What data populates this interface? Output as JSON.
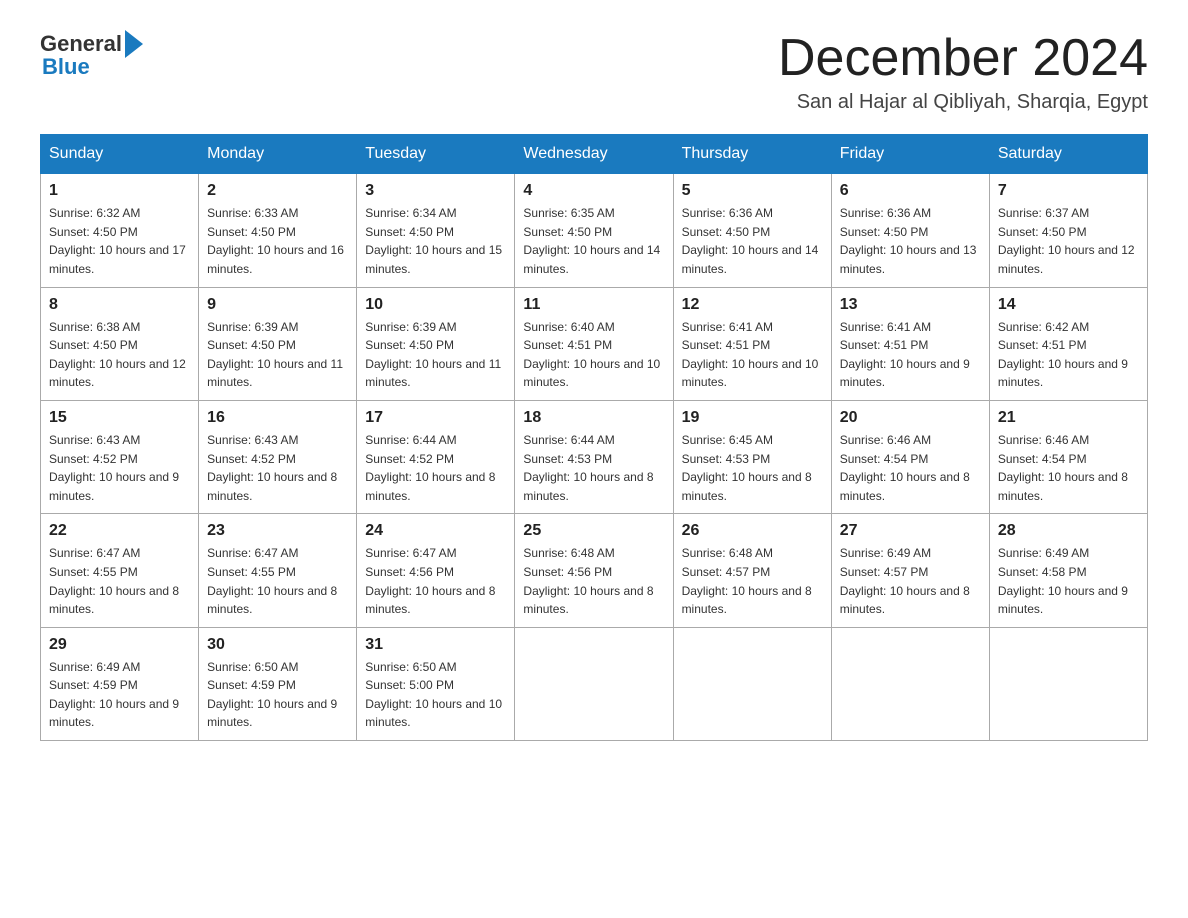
{
  "logo": {
    "general": "General",
    "blue": "Blue"
  },
  "header": {
    "month": "December 2024",
    "location": "San al Hajar al Qibliyah, Sharqia, Egypt"
  },
  "weekdays": [
    "Sunday",
    "Monday",
    "Tuesday",
    "Wednesday",
    "Thursday",
    "Friday",
    "Saturday"
  ],
  "weeks": [
    [
      {
        "day": "1",
        "sunrise": "6:32 AM",
        "sunset": "4:50 PM",
        "daylight": "10 hours and 17 minutes."
      },
      {
        "day": "2",
        "sunrise": "6:33 AM",
        "sunset": "4:50 PM",
        "daylight": "10 hours and 16 minutes."
      },
      {
        "day": "3",
        "sunrise": "6:34 AM",
        "sunset": "4:50 PM",
        "daylight": "10 hours and 15 minutes."
      },
      {
        "day": "4",
        "sunrise": "6:35 AM",
        "sunset": "4:50 PM",
        "daylight": "10 hours and 14 minutes."
      },
      {
        "day": "5",
        "sunrise": "6:36 AM",
        "sunset": "4:50 PM",
        "daylight": "10 hours and 14 minutes."
      },
      {
        "day": "6",
        "sunrise": "6:36 AM",
        "sunset": "4:50 PM",
        "daylight": "10 hours and 13 minutes."
      },
      {
        "day": "7",
        "sunrise": "6:37 AM",
        "sunset": "4:50 PM",
        "daylight": "10 hours and 12 minutes."
      }
    ],
    [
      {
        "day": "8",
        "sunrise": "6:38 AM",
        "sunset": "4:50 PM",
        "daylight": "10 hours and 12 minutes."
      },
      {
        "day": "9",
        "sunrise": "6:39 AM",
        "sunset": "4:50 PM",
        "daylight": "10 hours and 11 minutes."
      },
      {
        "day": "10",
        "sunrise": "6:39 AM",
        "sunset": "4:50 PM",
        "daylight": "10 hours and 11 minutes."
      },
      {
        "day": "11",
        "sunrise": "6:40 AM",
        "sunset": "4:51 PM",
        "daylight": "10 hours and 10 minutes."
      },
      {
        "day": "12",
        "sunrise": "6:41 AM",
        "sunset": "4:51 PM",
        "daylight": "10 hours and 10 minutes."
      },
      {
        "day": "13",
        "sunrise": "6:41 AM",
        "sunset": "4:51 PM",
        "daylight": "10 hours and 9 minutes."
      },
      {
        "day": "14",
        "sunrise": "6:42 AM",
        "sunset": "4:51 PM",
        "daylight": "10 hours and 9 minutes."
      }
    ],
    [
      {
        "day": "15",
        "sunrise": "6:43 AM",
        "sunset": "4:52 PM",
        "daylight": "10 hours and 9 minutes."
      },
      {
        "day": "16",
        "sunrise": "6:43 AM",
        "sunset": "4:52 PM",
        "daylight": "10 hours and 8 minutes."
      },
      {
        "day": "17",
        "sunrise": "6:44 AM",
        "sunset": "4:52 PM",
        "daylight": "10 hours and 8 minutes."
      },
      {
        "day": "18",
        "sunrise": "6:44 AM",
        "sunset": "4:53 PM",
        "daylight": "10 hours and 8 minutes."
      },
      {
        "day": "19",
        "sunrise": "6:45 AM",
        "sunset": "4:53 PM",
        "daylight": "10 hours and 8 minutes."
      },
      {
        "day": "20",
        "sunrise": "6:46 AM",
        "sunset": "4:54 PM",
        "daylight": "10 hours and 8 minutes."
      },
      {
        "day": "21",
        "sunrise": "6:46 AM",
        "sunset": "4:54 PM",
        "daylight": "10 hours and 8 minutes."
      }
    ],
    [
      {
        "day": "22",
        "sunrise": "6:47 AM",
        "sunset": "4:55 PM",
        "daylight": "10 hours and 8 minutes."
      },
      {
        "day": "23",
        "sunrise": "6:47 AM",
        "sunset": "4:55 PM",
        "daylight": "10 hours and 8 minutes."
      },
      {
        "day": "24",
        "sunrise": "6:47 AM",
        "sunset": "4:56 PM",
        "daylight": "10 hours and 8 minutes."
      },
      {
        "day": "25",
        "sunrise": "6:48 AM",
        "sunset": "4:56 PM",
        "daylight": "10 hours and 8 minutes."
      },
      {
        "day": "26",
        "sunrise": "6:48 AM",
        "sunset": "4:57 PM",
        "daylight": "10 hours and 8 minutes."
      },
      {
        "day": "27",
        "sunrise": "6:49 AM",
        "sunset": "4:57 PM",
        "daylight": "10 hours and 8 minutes."
      },
      {
        "day": "28",
        "sunrise": "6:49 AM",
        "sunset": "4:58 PM",
        "daylight": "10 hours and 9 minutes."
      }
    ],
    [
      {
        "day": "29",
        "sunrise": "6:49 AM",
        "sunset": "4:59 PM",
        "daylight": "10 hours and 9 minutes."
      },
      {
        "day": "30",
        "sunrise": "6:50 AM",
        "sunset": "4:59 PM",
        "daylight": "10 hours and 9 minutes."
      },
      {
        "day": "31",
        "sunrise": "6:50 AM",
        "sunset": "5:00 PM",
        "daylight": "10 hours and 10 minutes."
      },
      null,
      null,
      null,
      null
    ]
  ]
}
